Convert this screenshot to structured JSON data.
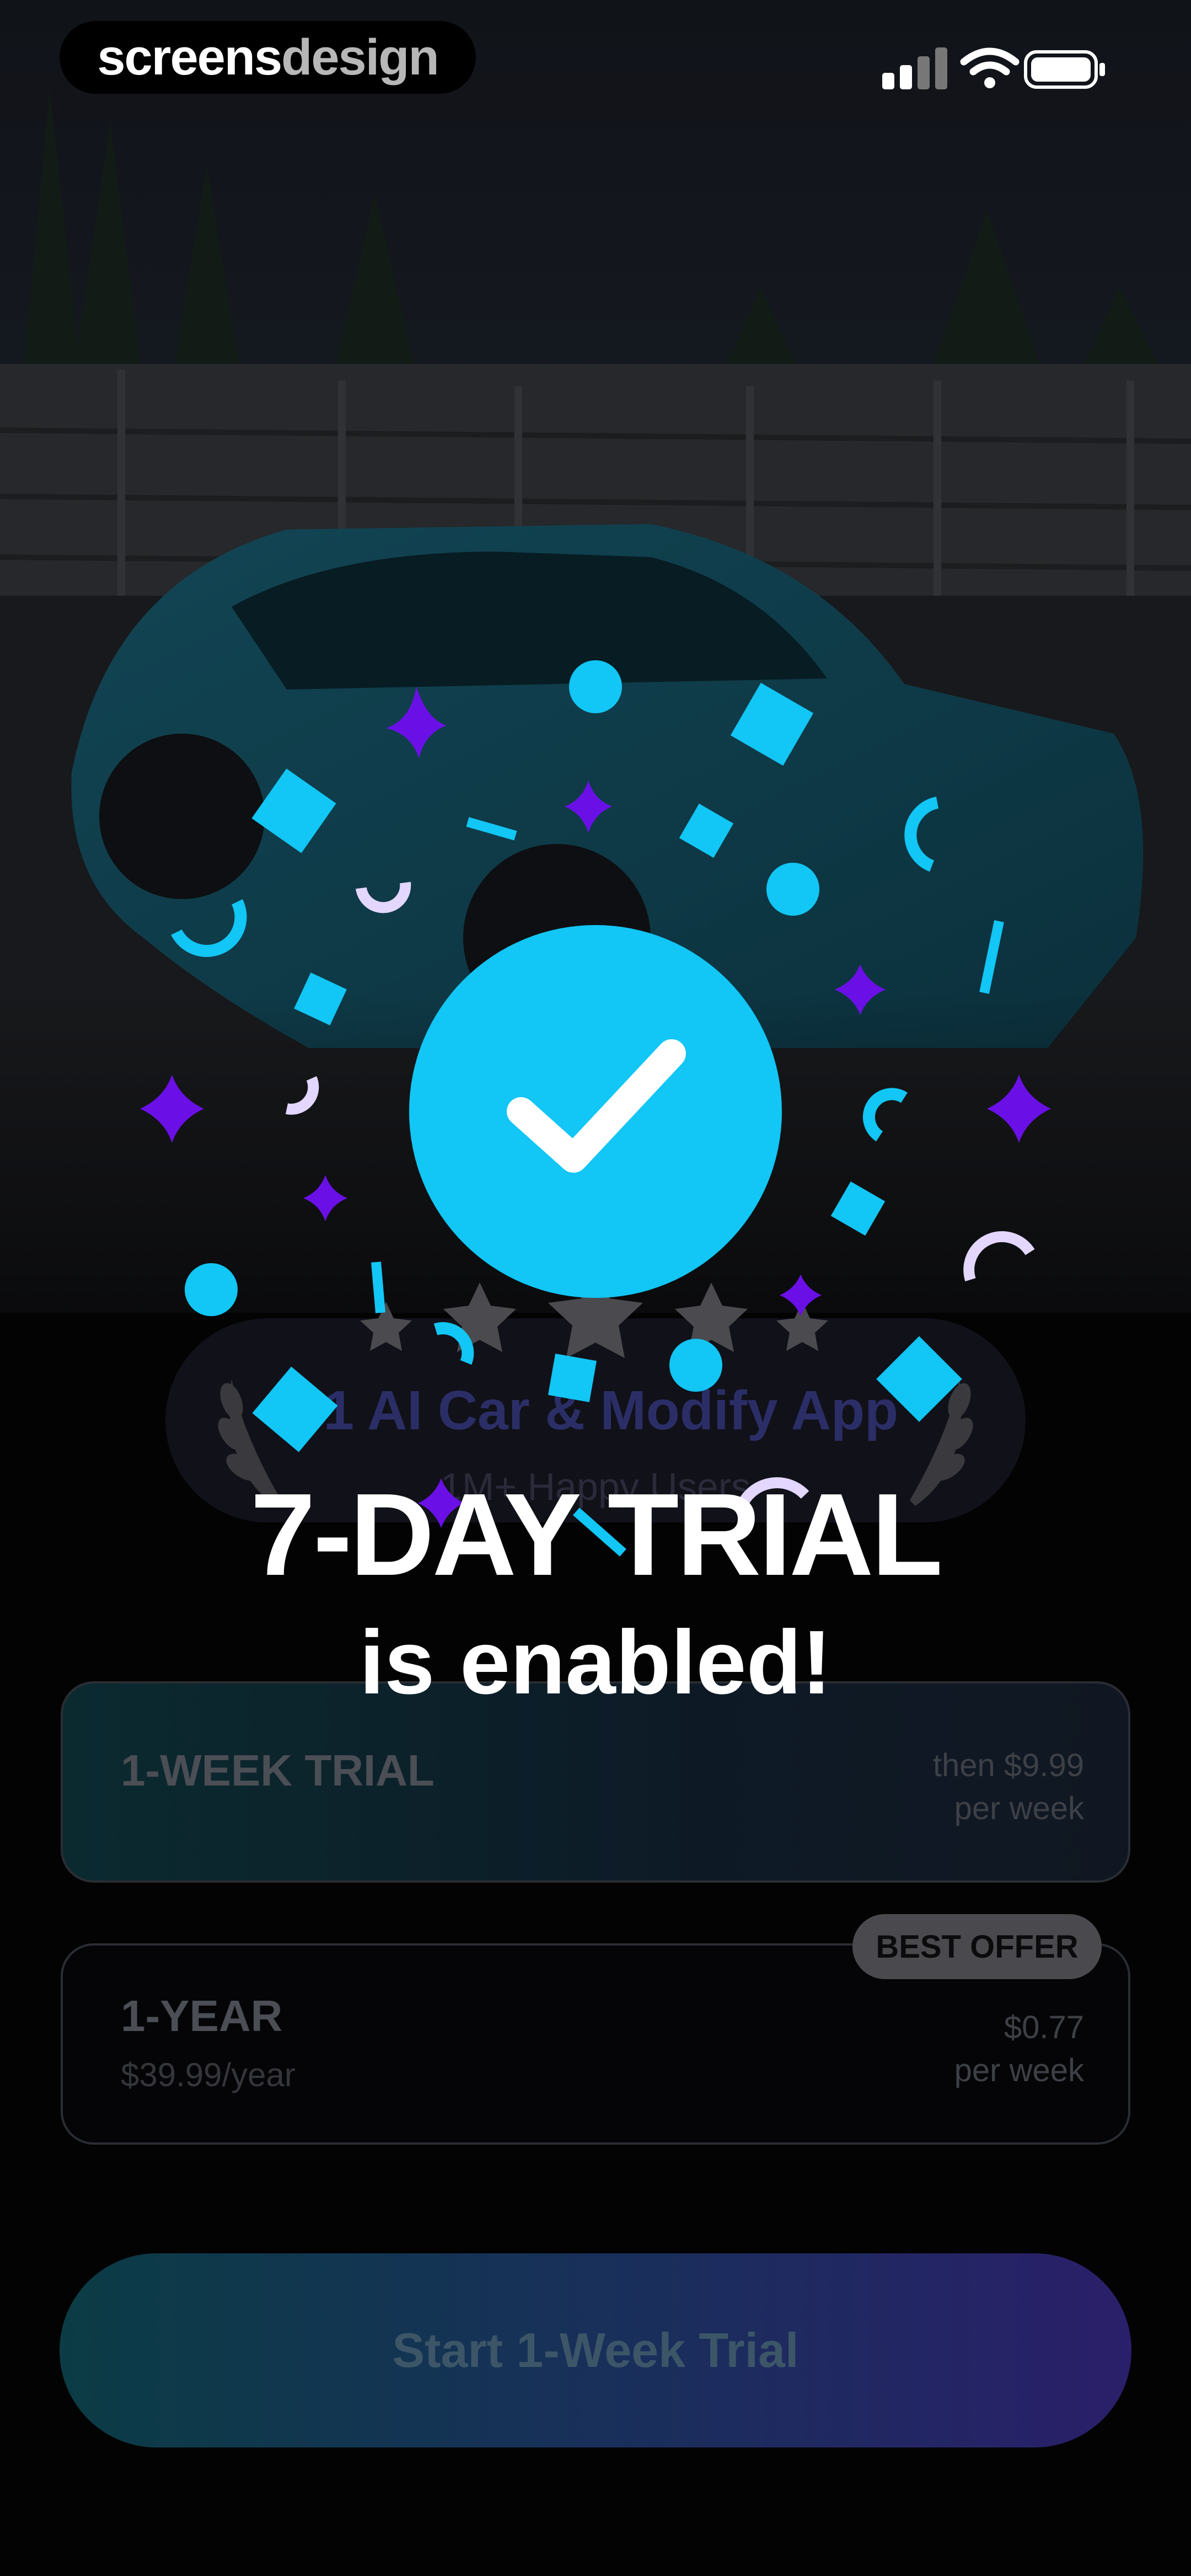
{
  "status_bar": {
    "brand_part1": "screens",
    "brand_part2": "design"
  },
  "award": {
    "title": "#1 AI Car & Modify App",
    "subtitle": "1M+ Happy Users"
  },
  "plans": [
    {
      "name": "1-WEEK TRIAL",
      "sub": "",
      "right_line1": "then $9.99",
      "right_line2": "per week"
    },
    {
      "name": "1-YEAR",
      "sub": "$39.99/year",
      "right_line1": "$0.77",
      "right_line2": "per week",
      "badge": "BEST OFFER"
    }
  ],
  "cta_label": "Start 1-Week Trial",
  "overlay": {
    "headline": "7-DAY TRIAL",
    "subline": "is enabled!"
  },
  "colors": {
    "accent_cyan": "#12C6F5",
    "accent_purple": "#6A10E6",
    "accent_lilac": "#E3D6FF"
  }
}
